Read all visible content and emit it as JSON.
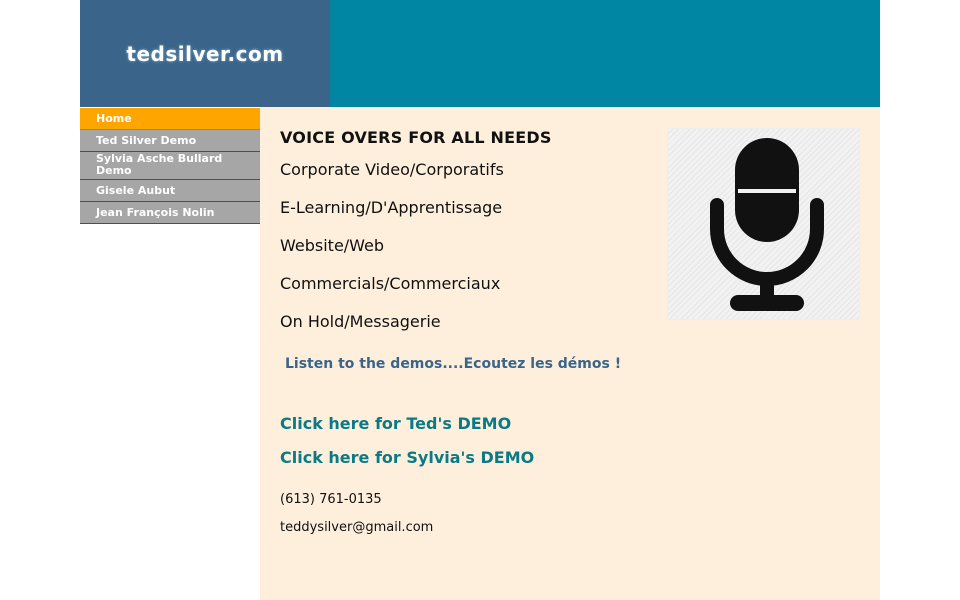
{
  "header": {
    "logo_text": "tedsilver.com"
  },
  "nav": {
    "items": [
      {
        "label": "Home",
        "active": true
      },
      {
        "label": "Ted Silver Demo",
        "active": false
      },
      {
        "label": "Sylvia Asche Bullard Demo",
        "active": false
      },
      {
        "label": "Gisele Aubut",
        "active": false
      },
      {
        "label": "Jean François Nolin",
        "active": false
      }
    ]
  },
  "content": {
    "heading": "VOICE OVERS FOR ALL NEEDS",
    "services": [
      "Corporate Video/Corporatifs",
      "E-Learning/D'Apprentissage",
      "Website/Web",
      "Commercials/Commerciaux",
      "On Hold/Messagerie"
    ],
    "listen_text": "Listen to the demos....Ecoutez les démos !",
    "demo_links": [
      "Click here for Ted's DEMO",
      "Click here for Sylvia's DEMO"
    ],
    "phone": "(613)  761-0135",
    "email": "teddysilver@gmail.com"
  },
  "colors": {
    "header_logo_bg": "#3a6489",
    "header_band_bg": "#0086a2",
    "nav_active_bg": "#ffa500",
    "nav_bg": "#a6a6a6",
    "content_bg": "#feefdc",
    "link_color": "#0a7a86",
    "listen_color": "#3a6489"
  },
  "icons": {
    "hero_image": "microphone-icon"
  }
}
